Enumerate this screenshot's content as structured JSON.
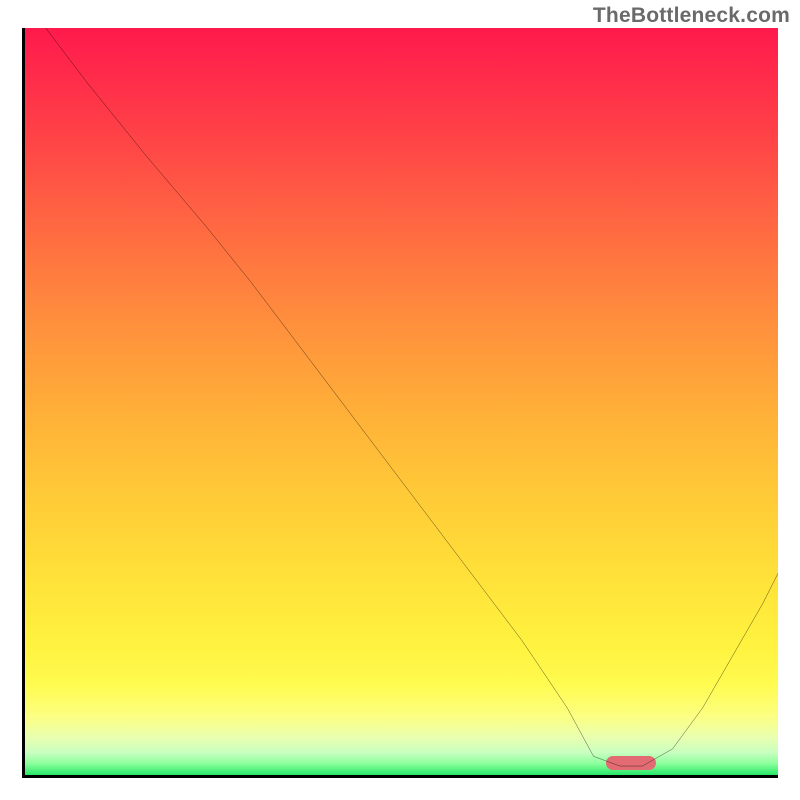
{
  "watermark": "TheBottleneck.com",
  "chart_data": {
    "type": "line",
    "title": "",
    "xlabel": "",
    "ylabel": "",
    "xlim": [
      0,
      100
    ],
    "ylim": [
      0,
      100
    ],
    "grid": false,
    "legend": false,
    "background_gradient": {
      "orientation": "vertical",
      "stops": [
        {
          "pos": 0.0,
          "color": "#ff1a4d"
        },
        {
          "pos": 0.5,
          "color": "#ffc038"
        },
        {
          "pos": 0.88,
          "color": "#fffb50"
        },
        {
          "pos": 1.0,
          "color": "#25e768"
        }
      ]
    },
    "series": [
      {
        "name": "bottleneck-curve",
        "color": "#000000",
        "x": [
          2,
          8,
          16,
          24,
          30,
          36,
          42,
          48,
          54,
          60,
          66,
          72,
          75.5,
          79,
          82,
          86,
          90,
          94,
          98,
          100
        ],
        "values": [
          101,
          93,
          83,
          73.5,
          66,
          58,
          50,
          42,
          34,
          26,
          18,
          9,
          2.5,
          1.2,
          1.2,
          3.5,
          9,
          16,
          23,
          27
        ]
      }
    ],
    "marker": {
      "name": "target-marker",
      "x": 80.5,
      "y": 1.6,
      "color": "#e36b73",
      "shape": "pill"
    },
    "axes": {
      "left": true,
      "bottom": true,
      "right": false,
      "top": false,
      "color": "#000000"
    }
  }
}
